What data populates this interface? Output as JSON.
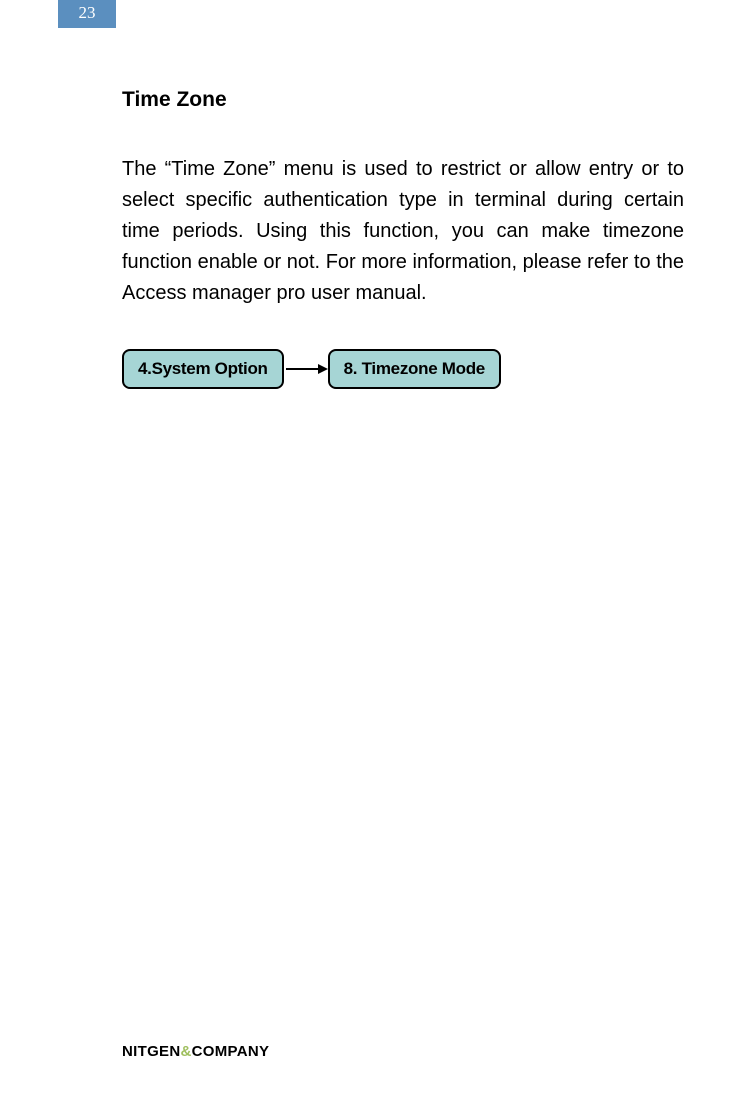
{
  "page_number": "23",
  "heading": "Time Zone",
  "paragraph": "The “Time Zone” menu is used to restrict or allow entry or to select specific authentication type in terminal during certain time periods. Using this function, you can make timezone function enable or not. For more information, please refer to the Access manager pro user manual.",
  "diagram": {
    "box1": "4.System Option",
    "box2": "8. Timezone Mode"
  },
  "footer": {
    "part1": "NITGEN",
    "amp": "&",
    "part2": "COMPANY"
  }
}
